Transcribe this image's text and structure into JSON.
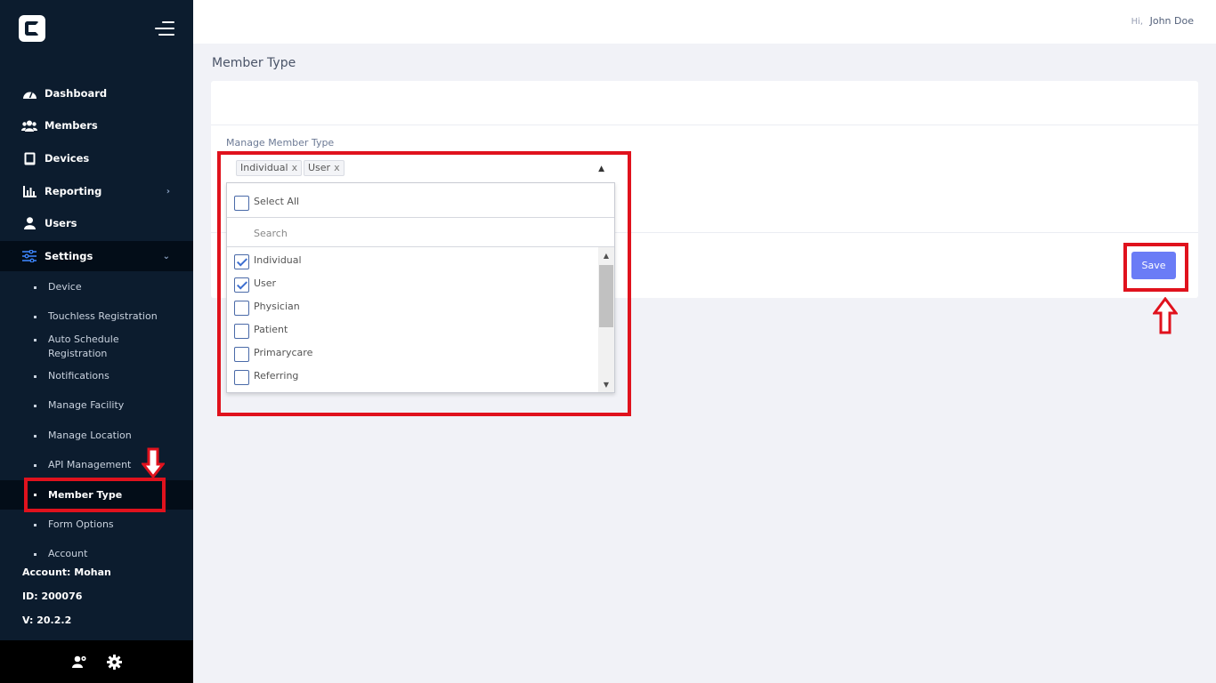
{
  "sidebar": {
    "nav": [
      {
        "label": "Dashboard",
        "icon": "dashboard-icon"
      },
      {
        "label": "Members",
        "icon": "members-icon"
      },
      {
        "label": "Devices",
        "icon": "tablet-icon"
      },
      {
        "label": "Reporting",
        "icon": "chart-icon"
      },
      {
        "label": "Users",
        "icon": "user-icon"
      },
      {
        "label": "Settings",
        "icon": "sliders-icon"
      }
    ],
    "settings_sub": [
      "Device",
      "Touchless Registration",
      "Auto Schedule Registration",
      "Notifications",
      "Manage Facility",
      "Manage Location",
      "API Management",
      "Member Type",
      "Form Options",
      "Account"
    ],
    "account": "Account: Mohan",
    "id": "ID: 200076",
    "version": "V: 20.2.2"
  },
  "header": {
    "hi": "Hi,",
    "user_name": "John Doe"
  },
  "page": {
    "title": "Member Type",
    "field_label": "Manage Member Type",
    "selected_chips": [
      "Individual",
      "User"
    ],
    "chip_remove": "x",
    "dropdown": {
      "select_all": "Select All",
      "search_placeholder": "Search",
      "options": [
        {
          "label": "Individual",
          "checked": true
        },
        {
          "label": "User",
          "checked": true
        },
        {
          "label": "Physician",
          "checked": false
        },
        {
          "label": "Patient",
          "checked": false
        },
        {
          "label": "Primarycare",
          "checked": false
        },
        {
          "label": "Referring",
          "checked": false
        }
      ]
    },
    "save_label": "Save"
  },
  "colors": {
    "sidebar_bg": "#0c1c2e",
    "sidebar_active_bg": "#030d18",
    "accent": "#6a7cf6",
    "annotation_red": "#e0121d"
  }
}
